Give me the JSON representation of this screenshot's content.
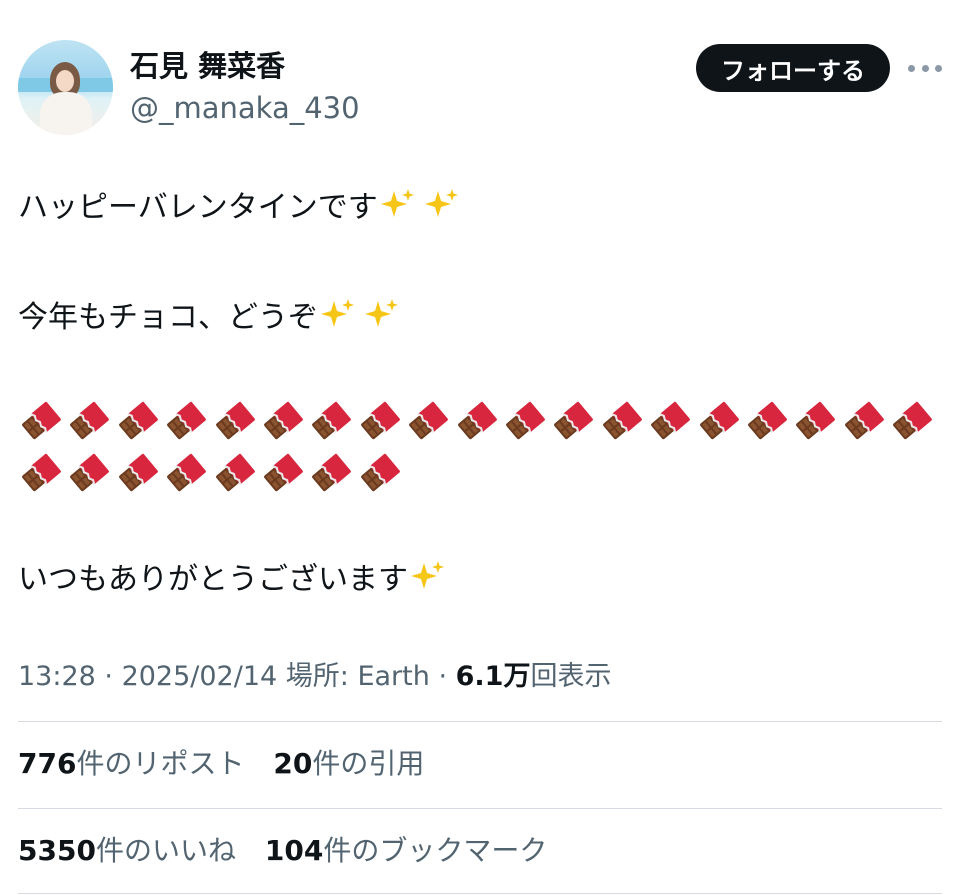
{
  "user": {
    "display_name": "石見 舞菜香",
    "handle": "@_manaka_430"
  },
  "follow_label": "フォローする",
  "tweet": {
    "line1": "ハッピーバレンタインです",
    "line2": "今年もチョコ、どうぞ",
    "line3": "いつもありがとうございます",
    "chocolate_count_row1": 19,
    "chocolate_count_row2": 8
  },
  "meta": {
    "time": "13:28",
    "sep1": " · ",
    "date": "2025/02/14",
    "location": " 場所: Earth",
    "sep2": " · ",
    "views_count": "6.1万",
    "views_label": "回表示"
  },
  "stats": {
    "reposts_count": "776",
    "reposts_label": "件のリポスト",
    "quotes_count": "20",
    "quotes_label": "件の引用",
    "likes_count": "5350",
    "likes_label": "件のいいね",
    "bookmarks_count": "104",
    "bookmarks_label": "件のブックマーク"
  },
  "colors": {
    "text_primary": "#0f1419",
    "text_secondary": "#536471",
    "follow_bg": "#0f1419",
    "divider": "#d5dbe0",
    "sparkle": "#f5c518",
    "chocolate": "#6b3a1f",
    "wrapper": "#d7263d"
  },
  "icons": {
    "sparkles": "sparkles-emoji",
    "chocolate": "chocolate-bar-emoji",
    "more": "more-icon"
  }
}
